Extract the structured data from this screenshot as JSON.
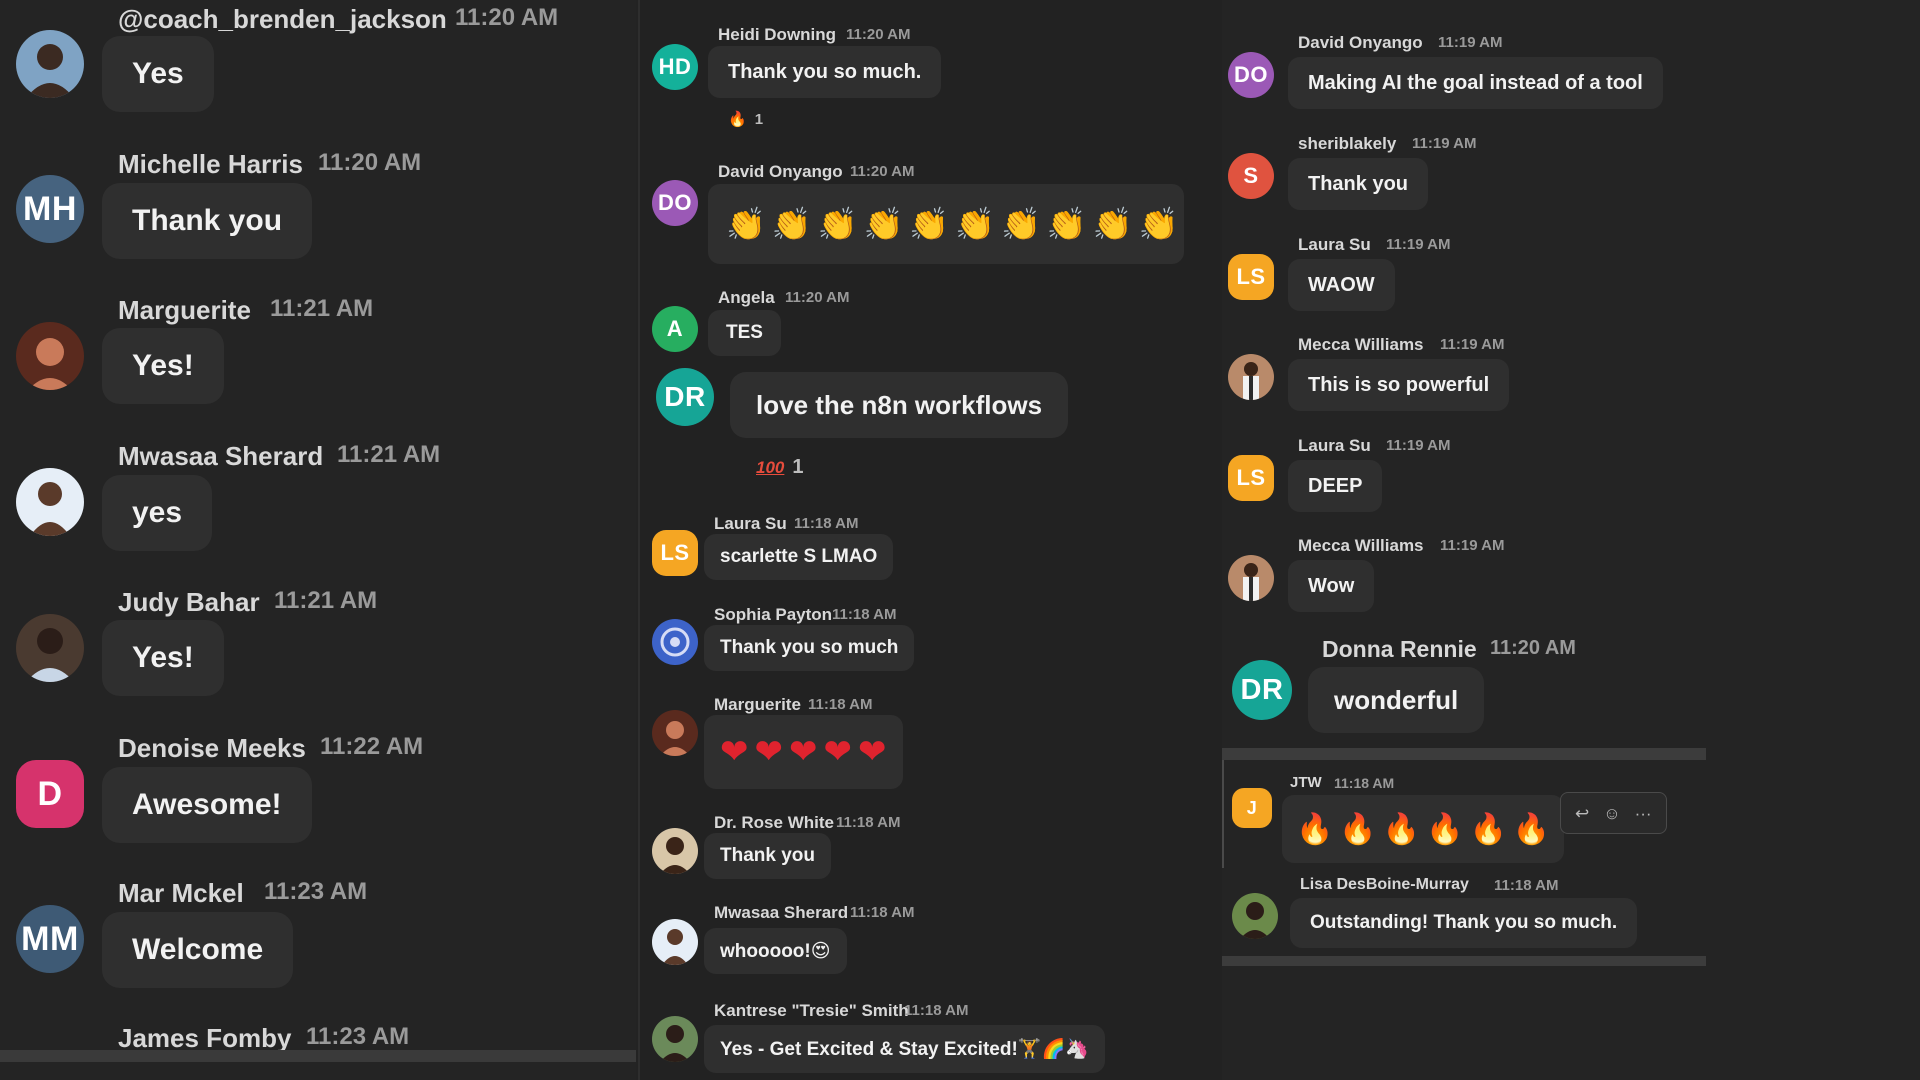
{
  "left": [
    {
      "name": "@coach_brenden_jackson",
      "time": "11:20 AM",
      "text": "Yes",
      "avatar": {
        "kind": "photo",
        "bg": "#7fa3c4",
        "fg": "#3b2a22"
      }
    },
    {
      "name": "Michelle Harris",
      "time": "11:20 AM",
      "text": "Thank you",
      "avatar": {
        "kind": "initials",
        "initials": "MH",
        "bg": "#46637f"
      }
    },
    {
      "name": "Marguerite",
      "time": "11:21 AM",
      "text": "Yes!",
      "avatar": {
        "kind": "photo",
        "bg": "#5a2a1e",
        "fg": "#c97a5a"
      }
    },
    {
      "name": "Mwasaa Sherard",
      "time": "11:21 AM",
      "text": "yes",
      "avatar": {
        "kind": "photo",
        "bg": "#e6eef7",
        "fg": "#5a3a2a"
      }
    },
    {
      "name": "Judy Bahar",
      "time": "11:21 AM",
      "text": "Yes!",
      "avatar": {
        "kind": "photo",
        "bg": "#4a3a30",
        "fg": "#2b1d18"
      }
    },
    {
      "name": "Denoise Meeks",
      "time": "11:22 AM",
      "text": "Awesome!",
      "avatar": {
        "kind": "initials",
        "initials": "D",
        "bg": "#d6336c"
      }
    },
    {
      "name": "Mar Mckel",
      "time": "11:23 AM",
      "text": "Welcome",
      "avatar": {
        "kind": "initials",
        "initials": "MM",
        "bg": "#3e5a75"
      }
    },
    {
      "name": "James Fomby",
      "time": "11:23 AM"
    }
  ],
  "middle": [
    {
      "name": "Heidi Downing",
      "time": "11:20 AM",
      "text": "Thank you so much.",
      "avatar": {
        "kind": "initials",
        "initials": "HD",
        "bg": "#14b19a"
      },
      "reaction": {
        "icon": "fire-icon",
        "count": "1"
      }
    },
    {
      "name": "David Onyango",
      "time": "11:20 AM",
      "emoji": "clap-icon",
      "emoji_count": 10,
      "avatar": {
        "kind": "initials",
        "initials": "DO",
        "bg": "#9b59b6"
      }
    },
    {
      "name": "Angela",
      "time": "11:20 AM",
      "text": "TES",
      "avatar": {
        "kind": "initials",
        "initials": "A",
        "bg": "#27ae60"
      }
    },
    {
      "text": "love the n8n workflows",
      "avatar": {
        "kind": "initials",
        "initials": "DR",
        "bg": "#16a596"
      },
      "reaction": {
        "icon": "hundred-icon",
        "count": "1"
      }
    },
    {
      "name": "Laura Su",
      "time": "11:18 AM",
      "text": "scarlette S LMAO",
      "avatar": {
        "kind": "initials",
        "initials": "LS",
        "bg": "#f5a623"
      }
    },
    {
      "name": "Sophia Payton",
      "time": "11:18 AM",
      "text": "Thank you so much",
      "avatar": {
        "kind": "photo",
        "bg": "#3d63c9",
        "fg": "#d6dcf5"
      }
    },
    {
      "name": "Marguerite",
      "time": "11:18 AM",
      "emoji": "heart-icon",
      "emoji_count": 5,
      "avatar": {
        "kind": "photo",
        "bg": "#5a2a1e",
        "fg": "#c97a5a"
      }
    },
    {
      "name": "Dr. Rose White",
      "time": "11:18 AM",
      "text": "Thank  you",
      "avatar": {
        "kind": "photo",
        "bg": "#d8c6a8",
        "fg": "#3a2418"
      }
    },
    {
      "name": "Mwasaa Sherard",
      "time": "11:18 AM",
      "text": "whooooo!😍",
      "avatar": {
        "kind": "photo",
        "bg": "#e6eef7",
        "fg": "#5a3a2a"
      }
    },
    {
      "name": "Kantrese \"Tresie\" Smith",
      "time": "11:18 AM",
      "text": "Yes - Get Excited & Stay Excited!🏋🌈🦄",
      "avatar": {
        "kind": "photo",
        "bg": "#6b8a5a",
        "fg": "#2b1d18"
      }
    }
  ],
  "right": [
    {
      "name": "David Onyango",
      "time": "11:19 AM",
      "text": "Making AI the goal instead of a tool",
      "avatar": {
        "kind": "initials",
        "initials": "DO",
        "bg": "#9b59b6"
      }
    },
    {
      "name": "sheriblakely",
      "time": "11:19 AM",
      "text": "Thank you",
      "avatar": {
        "kind": "initials",
        "initials": "S",
        "bg": "#e0533f"
      }
    },
    {
      "name": "Laura Su",
      "time": "11:19 AM",
      "text": "WAOW",
      "avatar": {
        "kind": "initials",
        "initials": "LS",
        "bg": "#f5a623"
      }
    },
    {
      "name": "Mecca Williams",
      "time": "11:19 AM",
      "text": "This is so powerful",
      "avatar": {
        "kind": "photo",
        "bg": "#b98a6a",
        "fg": "#f2f2f2"
      }
    },
    {
      "name": "Laura Su",
      "time": "11:19 AM",
      "text": "DEEP",
      "avatar": {
        "kind": "initials",
        "initials": "LS",
        "bg": "#f5a623"
      }
    },
    {
      "name": "Mecca Williams",
      "time": "11:19 AM",
      "text": "Wow",
      "avatar": {
        "kind": "photo",
        "bg": "#b98a6a",
        "fg": "#f2f2f2"
      }
    },
    {
      "name": "Donna Rennie",
      "time": "11:20 AM",
      "text": "wonderful",
      "avatar": {
        "kind": "initials",
        "initials": "DR",
        "bg": "#16a596"
      }
    },
    {
      "name": "JTW",
      "time": "11:18 AM",
      "emoji": "fire-icon",
      "emoji_count": 6,
      "avatar": {
        "kind": "initials",
        "initials": "J",
        "bg": "#f5a623"
      }
    },
    {
      "name": "Lisa DesBoine-Murray",
      "time": "11:18 AM",
      "text": "Outstanding! Thank you so much.",
      "avatar": {
        "kind": "photo",
        "bg": "#6b8a4a",
        "fg": "#2b1d18"
      }
    }
  ],
  "actions": {
    "reply_icon": "reply-icon",
    "emoji_icon": "add-reaction-icon",
    "more_icon": "more-icon",
    "more_label": "···"
  }
}
